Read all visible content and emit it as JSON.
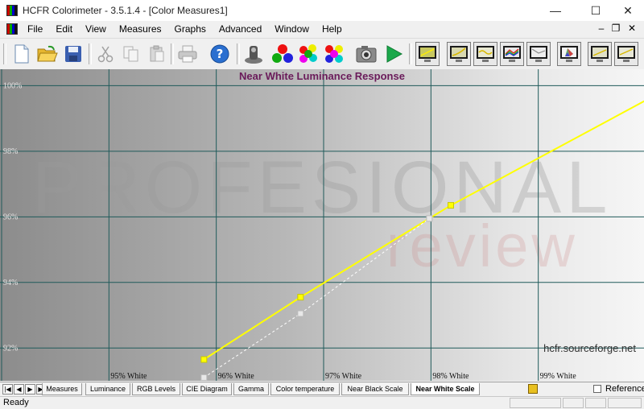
{
  "window": {
    "title": "HCFR Colorimeter - 3.5.1.4 - [Color Measures1]",
    "minimize": "—",
    "maximize": "☐",
    "close": "✕"
  },
  "menu": {
    "items": [
      "File",
      "Edit",
      "View",
      "Measures",
      "Graphs",
      "Advanced",
      "Window",
      "Help"
    ],
    "mdi_minimize": "–",
    "mdi_restore": "❐",
    "mdi_close": "✕"
  },
  "graph": {
    "title": "Near White Luminance Response",
    "source_url": "hcfr.sourceforge.net"
  },
  "chart_data": {
    "type": "line",
    "title": "Near White Luminance Response",
    "x_ticks": [
      "95% White",
      "96% White",
      "97% White",
      "98% White",
      "99% White"
    ],
    "y_ticks": [
      "92%",
      "94%",
      "96%",
      "98%",
      "100%"
    ],
    "ylim": [
      91,
      100.5
    ],
    "xlim": [
      94,
      100
    ],
    "grid": true,
    "series": [
      {
        "x": [
          95.9,
          96.8,
          98.2,
          100.1
        ],
        "y": [
          91.65,
          93.55,
          96.35,
          99.7
        ],
        "color": "#ffff00",
        "markers": [
          96.0,
          96.8,
          98.0
        ]
      },
      {
        "x": [
          95.9,
          96.8,
          98.0
        ],
        "y": [
          91.1,
          93.05,
          95.95
        ],
        "color": "#ffffff",
        "dashed": true
      }
    ]
  },
  "tabs": {
    "items": [
      "Measures",
      "Luminance",
      "RGB Levels",
      "CIE Diagram",
      "Gamma",
      "Color temperature",
      "Near Black Scale",
      "Near White Scale"
    ],
    "active": "Near White Scale",
    "nav": [
      "|◀",
      "◀",
      "▶",
      "▶|"
    ],
    "reference_label": "Reference"
  },
  "status": {
    "text": "Ready"
  }
}
